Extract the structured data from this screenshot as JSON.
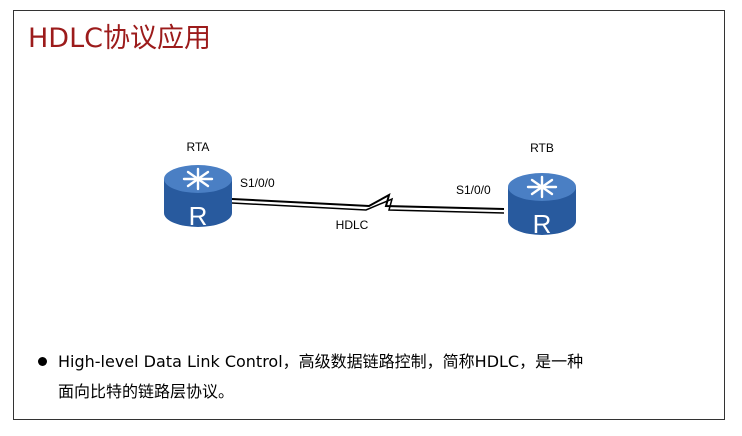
{
  "title": "HDLC协议应用",
  "colors": {
    "title": "#9c1b1b",
    "router_fill": "#285a9e",
    "router_top": "#4a7fc4",
    "router_icon": "#ffffff",
    "link": "#000000"
  },
  "topology": {
    "router_a": {
      "name": "RTA",
      "interface": "S1/0/0",
      "icon_letter": "R"
    },
    "router_b": {
      "name": "RTB",
      "interface": "S1/0/0",
      "icon_letter": "R"
    },
    "link": {
      "protocol": "HDLC"
    }
  },
  "bullet": {
    "text_line1": "High-level Data Link Control，高级数据链路控制，简称HDLC，是一种",
    "text_line2": "面向比特的链路层协议。"
  }
}
